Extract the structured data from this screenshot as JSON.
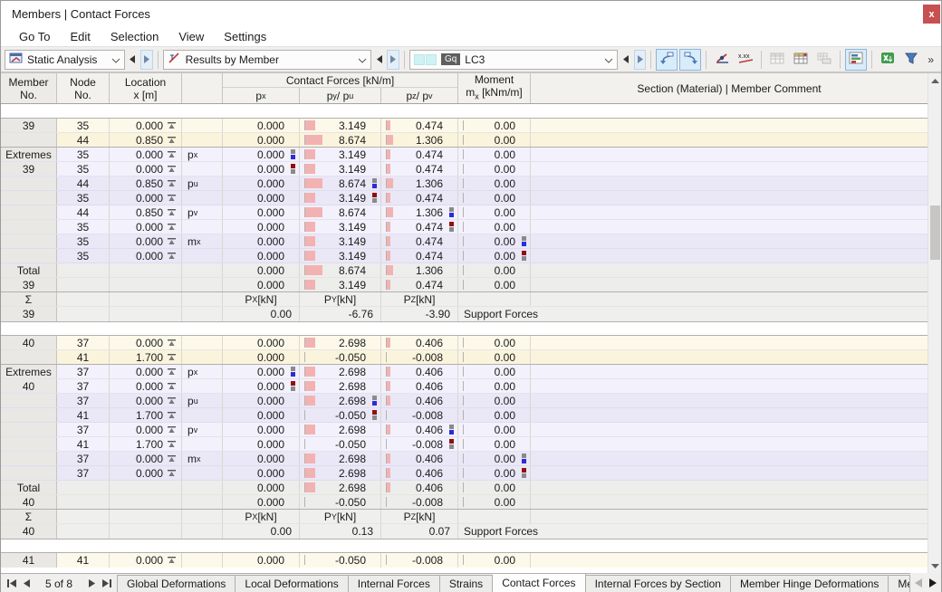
{
  "window": {
    "title": "Members | Contact Forces",
    "close_label": "x"
  },
  "menu": {
    "items": [
      "Go To",
      "Edit",
      "Selection",
      "View",
      "Settings"
    ]
  },
  "toolbar": {
    "combos": [
      {
        "label": "Static Analysis"
      },
      {
        "label": "Results by Member"
      },
      {
        "label": "LC3",
        "badge": "Gq"
      }
    ],
    "buttons": [
      {
        "name": "jump-previous-table-button",
        "icon": "curve-left-icon",
        "highlight": true
      },
      {
        "name": "jump-next-table-button",
        "icon": "curve-right-icon",
        "highlight": true
      },
      {
        "sep": true
      },
      {
        "name": "result-diagram-button",
        "icon": "diagram-icon"
      },
      {
        "name": "decimal-places-button",
        "icon": "decimals-icon"
      },
      {
        "sep": true
      },
      {
        "name": "table-display-button",
        "icon": "table-icon",
        "disabled": true
      },
      {
        "name": "table-filter-button",
        "icon": "table-header-icon"
      },
      {
        "name": "table-print-button",
        "icon": "table-print-icon",
        "disabled": true
      },
      {
        "sep": true
      },
      {
        "name": "result-bars-button",
        "icon": "chart-icon",
        "highlight": true
      },
      {
        "sep": true
      },
      {
        "name": "excel-export-button",
        "icon": "excel-icon"
      },
      {
        "name": "filter-button",
        "icon": "funnel-icon"
      }
    ],
    "overflow_label": "»"
  },
  "table": {
    "header": {
      "member_l1": "Member",
      "member_l2": "No.",
      "node_l1": "Node",
      "node_l2": "No.",
      "location_l1": "Location",
      "location_l2": "x [m]",
      "forces_group": "Contact Forces [kN/m]",
      "px": "p~x~",
      "py": "p~y~ / p~u~",
      "pz": "p~z~ / p~v~",
      "moment_l1": "Moment",
      "moment_l2": "m~x~ [kNm/m]",
      "section": "Section (Material) | Member Comment"
    },
    "sum_header": {
      "px": "P~X~ [kN]",
      "py": "P~Y~ [kN]",
      "pz": "P~Z~ [kN]"
    },
    "support_label": "Support Forces",
    "extremes_label": "Extremes",
    "total_label": "Total",
    "sigma_label": "Σ",
    "blocks": [
      {
        "member": "39",
        "results": [
          {
            "node": "35",
            "x": "0.000",
            "px": "0.000",
            "py": "3.149",
            "pz": "0.474",
            "mx": "0.00"
          },
          {
            "node": "44",
            "x": "0.850",
            "px": "0.000",
            "py": "8.674",
            "pz": "1.306",
            "mx": "0.00"
          }
        ],
        "extremes": [
          {
            "node": "35",
            "x": "0.000",
            "param": "p~x~",
            "px": "0.000",
            "py": "3.149",
            "pz": "0.474",
            "mx": "0.00",
            "marker": {
              "col": "px",
              "kind": "max"
            }
          },
          {
            "node": "35",
            "x": "0.000",
            "param": "",
            "px": "0.000",
            "py": "3.149",
            "pz": "0.474",
            "mx": "0.00",
            "marker": {
              "col": "px",
              "kind": "min"
            }
          },
          {
            "node": "44",
            "x": "0.850",
            "param": "p~u~",
            "px": "0.000",
            "py": "8.674",
            "pz": "1.306",
            "mx": "0.00",
            "marker": {
              "col": "py",
              "kind": "max"
            }
          },
          {
            "node": "35",
            "x": "0.000",
            "param": "",
            "px": "0.000",
            "py": "3.149",
            "pz": "0.474",
            "mx": "0.00",
            "marker": {
              "col": "py",
              "kind": "min"
            }
          },
          {
            "node": "44",
            "x": "0.850",
            "param": "p~v~",
            "px": "0.000",
            "py": "8.674",
            "pz": "1.306",
            "mx": "0.00",
            "marker": {
              "col": "pz",
              "kind": "max"
            }
          },
          {
            "node": "35",
            "x": "0.000",
            "param": "",
            "px": "0.000",
            "py": "3.149",
            "pz": "0.474",
            "mx": "0.00",
            "marker": {
              "col": "pz",
              "kind": "min"
            }
          },
          {
            "node": "35",
            "x": "0.000",
            "param": "m~x~",
            "px": "0.000",
            "py": "3.149",
            "pz": "0.474",
            "mx": "0.00",
            "marker": {
              "col": "mx",
              "kind": "max"
            }
          },
          {
            "node": "35",
            "x": "0.000",
            "param": "",
            "px": "0.000",
            "py": "3.149",
            "pz": "0.474",
            "mx": "0.00",
            "marker": {
              "col": "mx",
              "kind": "min"
            }
          }
        ],
        "totals": [
          {
            "px": "0.000",
            "py": "8.674",
            "pz": "1.306",
            "mx": "0.00"
          },
          {
            "px": "0.000",
            "py": "3.149",
            "pz": "0.474",
            "mx": "0.00"
          }
        ],
        "sums": {
          "px": "0.00",
          "py": "-6.76",
          "pz": "-3.90"
        }
      },
      {
        "member": "40",
        "results": [
          {
            "node": "37",
            "x": "0.000",
            "px": "0.000",
            "py": "2.698",
            "pz": "0.406",
            "mx": "0.00"
          },
          {
            "node": "41",
            "x": "1.700",
            "px": "0.000",
            "py": "-0.050",
            "pz": "-0.008",
            "mx": "0.00"
          }
        ],
        "extremes": [
          {
            "node": "37",
            "x": "0.000",
            "param": "p~x~",
            "px": "0.000",
            "py": "2.698",
            "pz": "0.406",
            "mx": "0.00",
            "marker": {
              "col": "px",
              "kind": "max"
            }
          },
          {
            "node": "37",
            "x": "0.000",
            "param": "",
            "px": "0.000",
            "py": "2.698",
            "pz": "0.406",
            "mx": "0.00",
            "marker": {
              "col": "px",
              "kind": "min"
            }
          },
          {
            "node": "37",
            "x": "0.000",
            "param": "p~u~",
            "px": "0.000",
            "py": "2.698",
            "pz": "0.406",
            "mx": "0.00",
            "marker": {
              "col": "py",
              "kind": "max"
            }
          },
          {
            "node": "41",
            "x": "1.700",
            "param": "",
            "px": "0.000",
            "py": "-0.050",
            "pz": "-0.008",
            "mx": "0.00",
            "marker": {
              "col": "py",
              "kind": "min"
            }
          },
          {
            "node": "37",
            "x": "0.000",
            "param": "p~v~",
            "px": "0.000",
            "py": "2.698",
            "pz": "0.406",
            "mx": "0.00",
            "marker": {
              "col": "pz",
              "kind": "max"
            }
          },
          {
            "node": "41",
            "x": "1.700",
            "param": "",
            "px": "0.000",
            "py": "-0.050",
            "pz": "-0.008",
            "mx": "0.00",
            "marker": {
              "col": "pz",
              "kind": "min"
            }
          },
          {
            "node": "37",
            "x": "0.000",
            "param": "m~x~",
            "px": "0.000",
            "py": "2.698",
            "pz": "0.406",
            "mx": "0.00",
            "marker": {
              "col": "mx",
              "kind": "max"
            }
          },
          {
            "node": "37",
            "x": "0.000",
            "param": "",
            "px": "0.000",
            "py": "2.698",
            "pz": "0.406",
            "mx": "0.00",
            "marker": {
              "col": "mx",
              "kind": "min"
            }
          }
        ],
        "totals": [
          {
            "px": "0.000",
            "py": "2.698",
            "pz": "0.406",
            "mx": "0.00"
          },
          {
            "px": "0.000",
            "py": "-0.050",
            "pz": "-0.008",
            "mx": "0.00"
          }
        ],
        "sums": {
          "px": "0.00",
          "py": "0.13",
          "pz": "0.07"
        }
      },
      {
        "member": "41",
        "partial": true,
        "results": [
          {
            "node": "41",
            "x": "0.000",
            "px": "0.000",
            "py": "-0.050",
            "pz": "-0.008",
            "mx": "0.00"
          }
        ],
        "extremes": [],
        "totals": []
      }
    ]
  },
  "footer": {
    "pager_label": "5 of 8",
    "tabs": [
      {
        "label": "Global Deformations"
      },
      {
        "label": "Local Deformations"
      },
      {
        "label": "Internal Forces"
      },
      {
        "label": "Strains"
      },
      {
        "label": "Contact Forces",
        "active": true
      },
      {
        "label": "Internal Forces by Section"
      },
      {
        "label": "Member Hinge Deformations"
      },
      {
        "label": "Member Hinge",
        "cut": true
      }
    ]
  },
  "colors": {
    "close_red": "#c75050",
    "bar_pink": "#f3b2b2",
    "marker_blue": "#2c2cd8",
    "marker_red": "#8f1010",
    "marker_gray": "#8a8a8a",
    "row_cream": "#fdf9ea",
    "row_lavender": "#f3f1fb",
    "row_gray": "#ededec",
    "highlight_bg": "#d9ecf9",
    "highlight_border": "#8ab6dd",
    "badge_bg": "#5f5f5f",
    "cyan_swatch": "#cff2f4"
  }
}
